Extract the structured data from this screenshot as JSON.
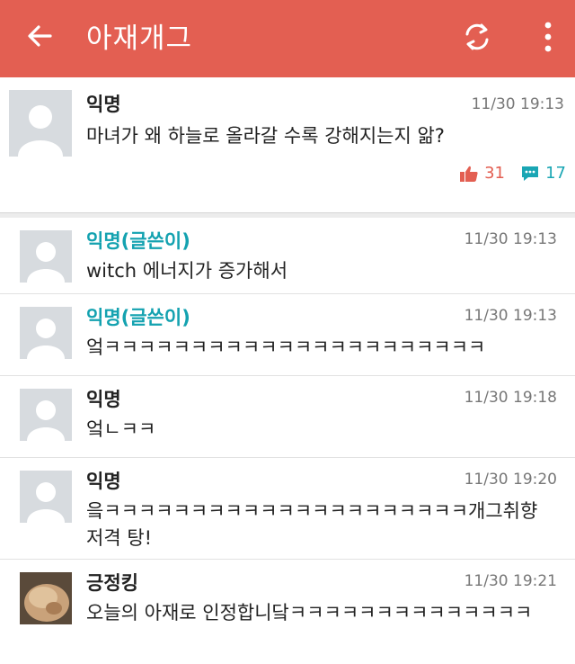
{
  "header": {
    "title": "아재개그",
    "back_icon": "arrow-left-icon",
    "refresh_icon": "refresh-icon",
    "more_icon": "more-vertical-icon",
    "bar_color": "#e35f52"
  },
  "post": {
    "author": "익명",
    "time": "11/30 19:13",
    "content": "마녀가 왜 하늘로 올라갈 수록 강해지는지 앎?",
    "likes": "31",
    "replies": "17",
    "like_icon": "thumbs-up-icon",
    "reply_icon": "comment-icon"
  },
  "comments": [
    {
      "author": "익명(글쓴이)",
      "time": "11/30 19:13",
      "content": "witch 에너지가 증가해서"
    },
    {
      "author": "익명(글쓴이)",
      "time": "11/30 19:13",
      "content": "엌ㅋㅋㅋㅋㅋㅋㅋㅋㅋㅋㅋㅋㅋㅋㅋㅋㅋㅋㅋㅋㅋㅋ"
    },
    {
      "author": "익명",
      "time": "11/30 19:18",
      "content": "엌ㄴㅋㅋ"
    },
    {
      "author": "익명",
      "time": "11/30 19:20",
      "content": "읔ㅋㅋㅋㅋㅋㅋㅋㅋㅋㅋㅋㅋㅋㅋㅋㅋㅋㅋㅋㅋㅋ개그취향 저격 탕!"
    },
    {
      "author": "긍정킹",
      "time": "11/30 19:21",
      "content": "오늘의 아재로 인정합니닼ㅋㅋㅋㅋㅋㅋㅋㅋㅋㅋㅋㅋㅋㅋ"
    }
  ]
}
